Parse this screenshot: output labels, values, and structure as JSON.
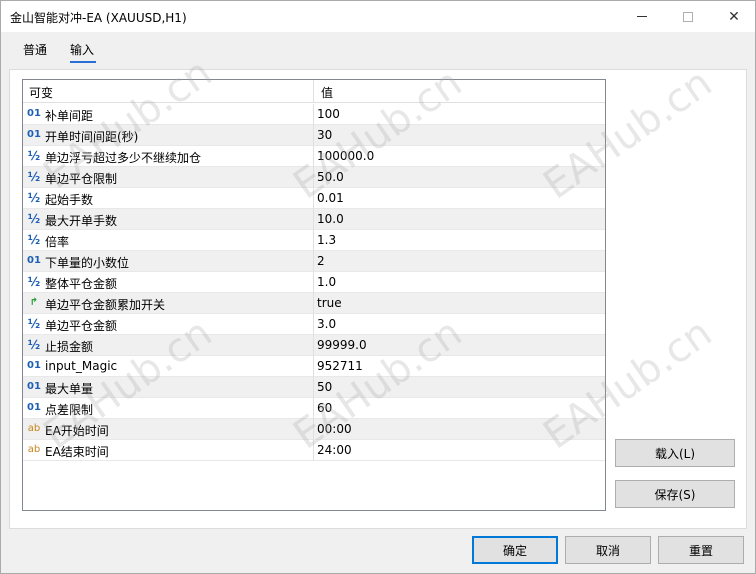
{
  "window": {
    "title": "金山智能对冲-EA (XAUUSD,H1)",
    "minimize_glyph": "—",
    "close_glyph": "✕"
  },
  "tabs": [
    {
      "label": "普通",
      "active": false
    },
    {
      "label": "输入",
      "active": true
    }
  ],
  "grid": {
    "header_variable": "可变",
    "header_value": "值",
    "rows": [
      {
        "type": "int",
        "icon": "01",
        "name": "补单间距",
        "value": "100"
      },
      {
        "type": "int",
        "icon": "01",
        "name": "开单时间间距(秒)",
        "value": "30"
      },
      {
        "type": "double",
        "icon": "½",
        "name": "单边浮亏超过多少不继续加仓",
        "value": "100000.0"
      },
      {
        "type": "double",
        "icon": "½",
        "name": "单边平仓限制",
        "value": "50.0"
      },
      {
        "type": "double",
        "icon": "½",
        "name": "起始手数",
        "value": "0.01"
      },
      {
        "type": "double",
        "icon": "½",
        "name": "最大开单手数",
        "value": "10.0"
      },
      {
        "type": "double",
        "icon": "½",
        "name": "倍率",
        "value": "1.3"
      },
      {
        "type": "int",
        "icon": "01",
        "name": "下单量的小数位",
        "value": "2"
      },
      {
        "type": "double",
        "icon": "½",
        "name": "整体平仓金额",
        "value": "1.0"
      },
      {
        "type": "bool",
        "icon": "↱",
        "name": "单边平仓金额累加开关",
        "value": "true"
      },
      {
        "type": "double",
        "icon": "½",
        "name": "单边平仓金额",
        "value": "3.0"
      },
      {
        "type": "double",
        "icon": "½",
        "name": "止损金额",
        "value": "99999.0"
      },
      {
        "type": "int",
        "icon": "01",
        "name": "input_Magic",
        "value": "952711"
      },
      {
        "type": "int",
        "icon": "01",
        "name": "最大单量",
        "value": "50"
      },
      {
        "type": "int",
        "icon": "01",
        "name": "点差限制",
        "value": "60"
      },
      {
        "type": "string",
        "icon": "ab",
        "name": "EA开始时间",
        "value": "00:00"
      },
      {
        "type": "string",
        "icon": "ab",
        "name": "EA结束时间",
        "value": "24:00"
      }
    ]
  },
  "buttons": {
    "load": "载入(L)",
    "save": "保存(S)",
    "ok": "确定",
    "cancel": "取消",
    "reset": "重置"
  },
  "watermark_text": "EAHub.cn"
}
